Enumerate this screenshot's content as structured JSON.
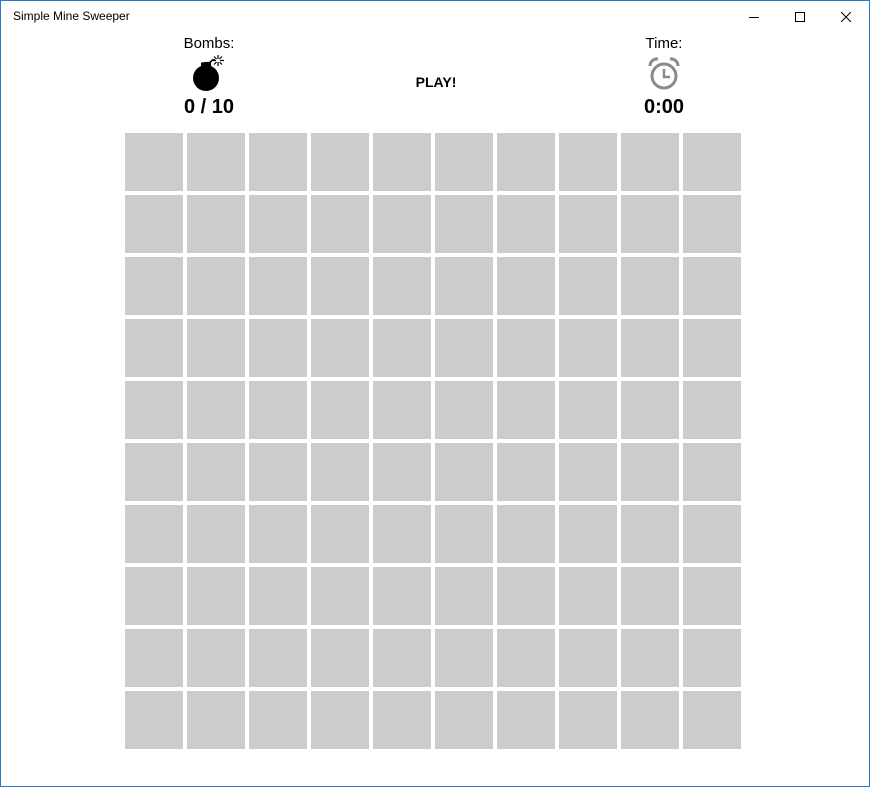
{
  "window": {
    "title": "Simple Mine Sweeper",
    "controls": [
      "minimize-icon",
      "maximize-icon",
      "close-icon"
    ]
  },
  "header": {
    "bombs_label": "Bombs:",
    "bombs_icon": "bomb-icon",
    "bombs_value": "0 / 10",
    "play_label": "PLAY!",
    "time_label": "Time:",
    "time_icon": "alarm-clock-icon",
    "time_value": "0:00"
  },
  "board": {
    "rows": 10,
    "columns": 10,
    "cell_state": "unrevealed",
    "cell_color": "#cccccc"
  },
  "colors": {
    "window_border": "#2b78c4",
    "bomb_icon": "#000000",
    "clock_icon": "#8a8a8a"
  }
}
